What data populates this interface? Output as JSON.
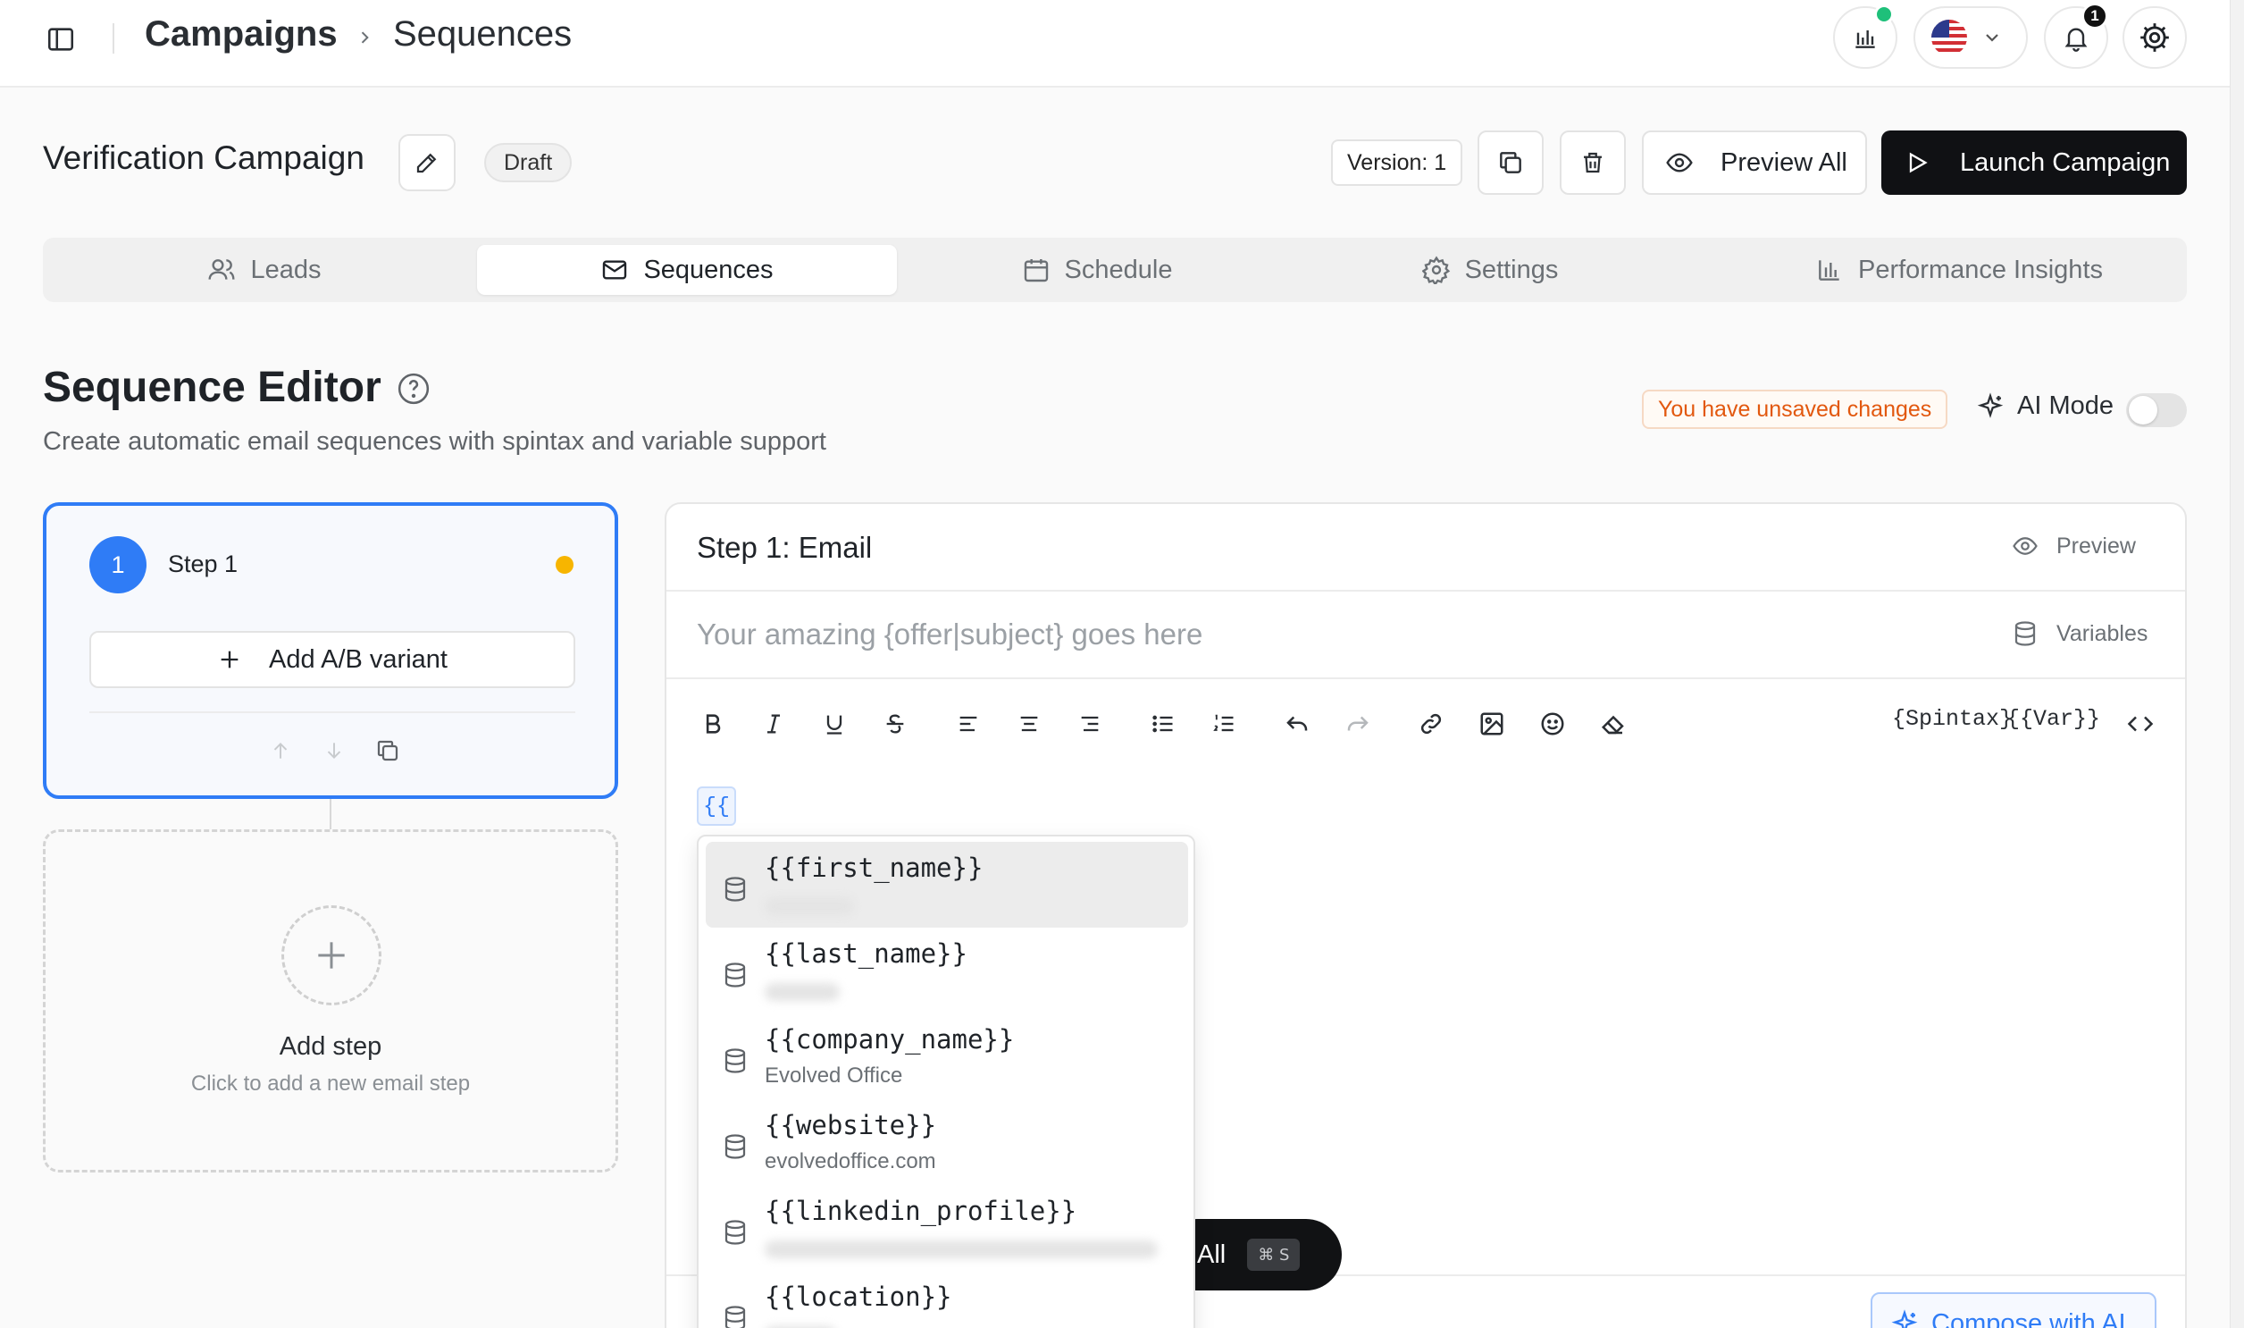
{
  "breadcrumb": {
    "root": "Campaigns",
    "current": "Sequences"
  },
  "topbar": {
    "notifications_count": "1"
  },
  "campaign": {
    "name": "Verification Campaign",
    "status": "Draft",
    "version": "Version: 1",
    "preview_all_label": "Preview All",
    "launch_label": "Launch Campaign"
  },
  "tabs": [
    {
      "label": "Leads",
      "icon": "users-icon",
      "active": false
    },
    {
      "label": "Sequences",
      "icon": "mail-icon",
      "active": true
    },
    {
      "label": "Schedule",
      "icon": "calendar-icon",
      "active": false
    },
    {
      "label": "Settings",
      "icon": "gear-icon",
      "active": false
    },
    {
      "label": "Performance Insights",
      "icon": "bar-chart-icon",
      "active": false
    }
  ],
  "editor": {
    "title": "Sequence Editor",
    "subtitle": "Create automatic email sequences with spintax and variable support",
    "unsaved_notice": "You have unsaved changes",
    "ai_mode_label": "AI Mode",
    "ai_mode_on": false
  },
  "steps": [
    {
      "number": "1",
      "label": "Step 1",
      "status_color": "#f7b500",
      "ab_variant_label": "Add A/B variant"
    }
  ],
  "add_step": {
    "title": "Add step",
    "subtitle": "Click to add a new email step"
  },
  "email": {
    "panel_title": "Step 1: Email",
    "preview_label": "Preview",
    "subject_placeholder": "Your amazing {offer|subject} goes here",
    "variables_label": "Variables",
    "spintax_label": "{Spintax}",
    "var_label": "{{Var}}",
    "token_chip": "{{",
    "compose_label": "Compose with AI"
  },
  "variables": [
    {
      "name": "{{first_name}}",
      "value": ""
    },
    {
      "name": "{{last_name}}",
      "value": ""
    },
    {
      "name": "{{company_name}}",
      "value": "Evolved Office"
    },
    {
      "name": "{{website}}",
      "value": "evolvedoffice.com"
    },
    {
      "name": "{{linkedin_profile}}",
      "value": ""
    },
    {
      "name": "{{location}}",
      "value": ""
    }
  ],
  "floating_pill": {
    "label": "All",
    "shortcut": "⌘ S"
  },
  "colors": {
    "accent": "#2f7cf6",
    "launch_bg": "#101114",
    "unsaved": "#e2580f",
    "online_dot": "#1ec07a"
  }
}
